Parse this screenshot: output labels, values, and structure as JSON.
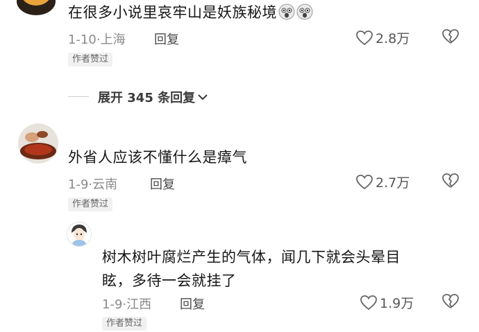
{
  "comments": [
    {
      "text": "在很多小说里哀牢山是妖族秘境",
      "emojis": [
        "shocked-face-icon",
        "shocked-face-icon"
      ],
      "date": "1-10",
      "location": "上海",
      "reply_label": "回复",
      "likes": "2.8万",
      "badge": "作者赞过"
    },
    {
      "text": "外省人应该不懂什么是瘴气",
      "date": "1-9",
      "location": "云南",
      "reply_label": "回复",
      "likes": "2.7万",
      "badge": "作者赞过"
    }
  ],
  "expand_replies": "展开 345 条回复",
  "sub_reply": {
    "text_line1": "树木树叶腐烂产生的气体，闻几下就会头晕目",
    "text_line2": "眩，多待一会就挂了",
    "date": "1-9",
    "location": "江西",
    "reply_label": "回复",
    "likes": "1.9万",
    "badge": "作者赞过"
  },
  "colors": {
    "meta": "#8a8a8a",
    "badge_bg": "#f1f1f1"
  }
}
